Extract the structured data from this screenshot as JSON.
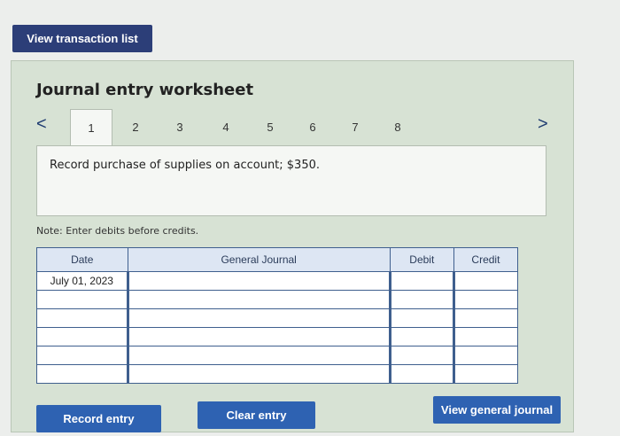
{
  "top_button": {
    "label": "View transaction list"
  },
  "worksheet": {
    "title": "Journal entry worksheet",
    "prev_glyph": "<",
    "next_glyph": ">",
    "tabs": [
      "1",
      "2",
      "3",
      "4",
      "5",
      "6",
      "7",
      "8"
    ],
    "active_tab": "1",
    "description": "Record purchase of supplies on account; $350.",
    "note": "Note: Enter debits before credits."
  },
  "journal_table": {
    "headers": {
      "date": "Date",
      "general_journal": "General Journal",
      "debit": "Debit",
      "credit": "Credit"
    },
    "rows": [
      {
        "date": "July 01, 2023",
        "account": "",
        "debit": "",
        "credit": ""
      },
      {
        "date": "",
        "account": "",
        "debit": "",
        "credit": ""
      },
      {
        "date": "",
        "account": "",
        "debit": "",
        "credit": ""
      },
      {
        "date": "",
        "account": "",
        "debit": "",
        "credit": ""
      },
      {
        "date": "",
        "account": "",
        "debit": "",
        "credit": ""
      },
      {
        "date": "",
        "account": "",
        "debit": "",
        "credit": ""
      }
    ]
  },
  "buttons": {
    "record": "Record entry",
    "clear": "Clear entry",
    "view_general": "View general journal"
  },
  "colors": {
    "primary_button": "#2e62b2",
    "top_button": "#2c3e78",
    "panel": "#d7e2d4"
  }
}
